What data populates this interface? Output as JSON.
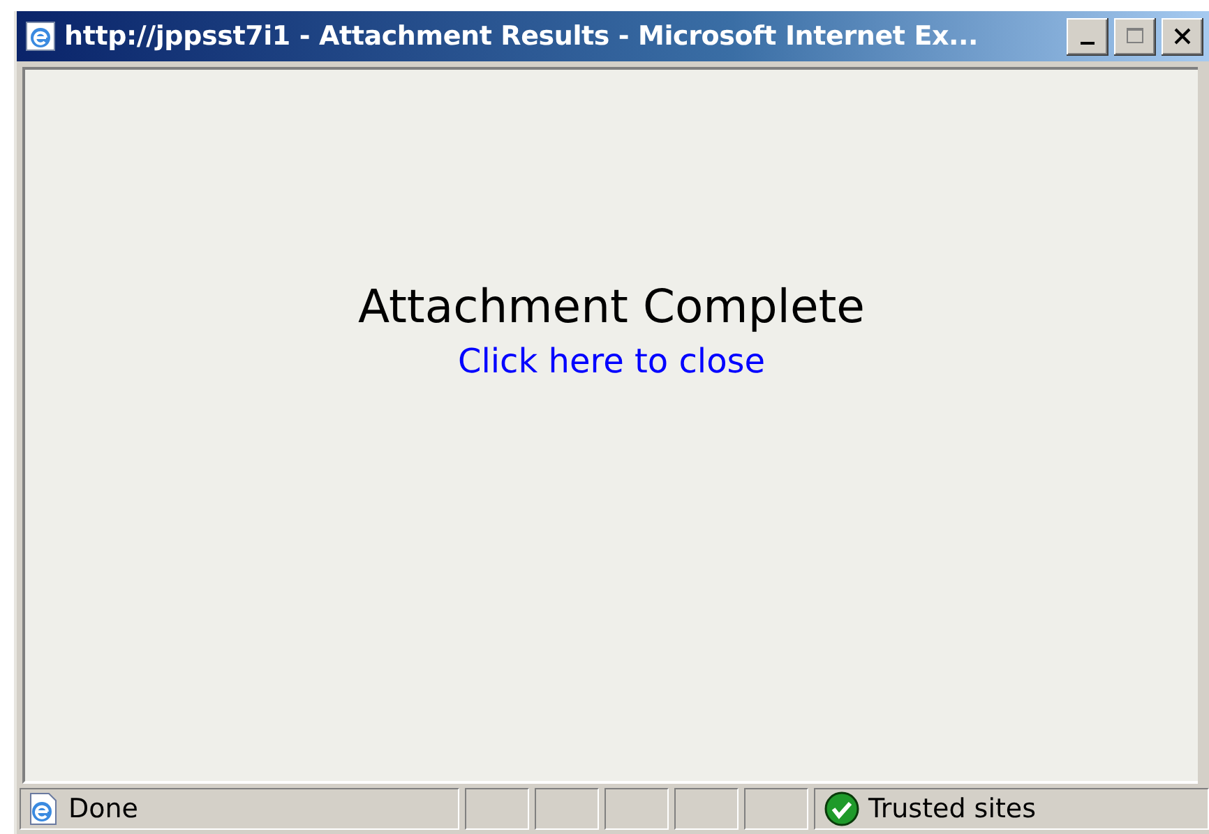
{
  "window": {
    "title": "http://jppsst7i1 - Attachment Results - Microsoft Internet Ex..."
  },
  "page": {
    "heading": "Attachment Complete",
    "link": "Click here to close"
  },
  "status_bar": {
    "status": "Done",
    "zone": "Trusted sites"
  }
}
